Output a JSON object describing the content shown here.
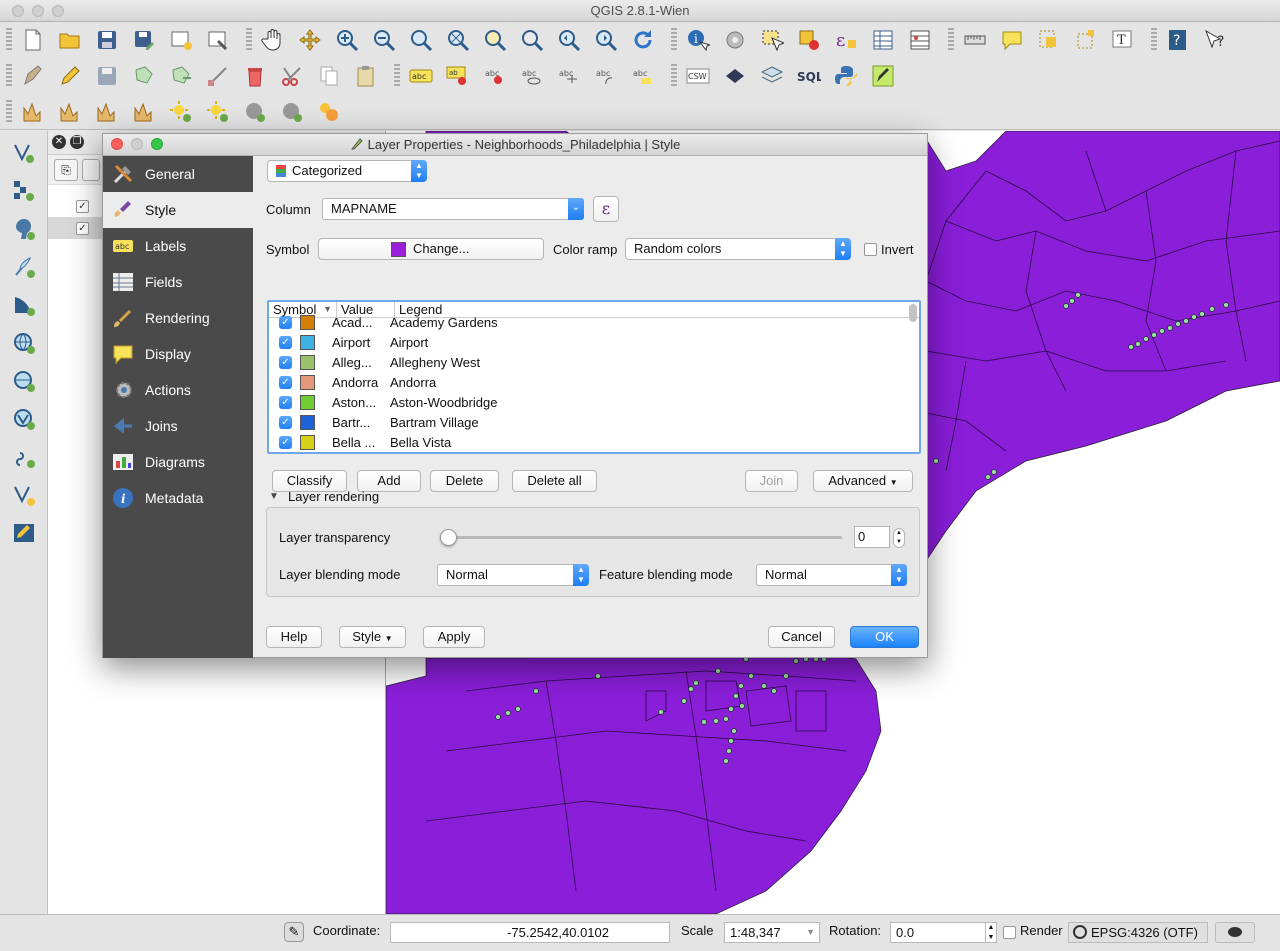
{
  "app": {
    "window_title": "QGIS 2.8.1-Wien"
  },
  "layers_panel": {
    "layers": [
      {
        "checked": "✓"
      },
      {
        "checked": "✓"
      }
    ]
  },
  "statusbar": {
    "coordinate_label": "Coordinate:",
    "coordinate_value": "-75.2542,40.0102",
    "scale_label": "Scale",
    "scale_value": "1:48,347",
    "rotation_label": "Rotation:",
    "rotation_value": "0.0",
    "render_label": "Render",
    "crs_value": "EPSG:4326 (OTF)"
  },
  "dialog": {
    "title": "Layer Properties - Neighborhoods_Philadelphia | Style",
    "sidebar": [
      {
        "label": "General",
        "icon": "tools-icon"
      },
      {
        "label": "Style",
        "icon": "paintbrush-icon"
      },
      {
        "label": "Labels",
        "icon": "abc-label-icon"
      },
      {
        "label": "Fields",
        "icon": "table-icon"
      },
      {
        "label": "Rendering",
        "icon": "brush-icon"
      },
      {
        "label": "Display",
        "icon": "speech-bubble-icon"
      },
      {
        "label": "Actions",
        "icon": "gear-icon"
      },
      {
        "label": "Joins",
        "icon": "join-icon"
      },
      {
        "label": "Diagrams",
        "icon": "chart-icon"
      },
      {
        "label": "Metadata",
        "icon": "info-icon"
      }
    ],
    "renderer_type": "Categorized",
    "column_label": "Column",
    "column_value": "MAPNAME",
    "expression_glyph": "ε",
    "symbol_label": "Symbol",
    "change_label": "Change...",
    "symbol_color": "#9b1fd8",
    "color_ramp_label": "Color ramp",
    "color_ramp_value": "Random colors",
    "invert_label": "Invert",
    "table_headers": {
      "symbol": "Symbol",
      "value": "Value",
      "legend": "Legend"
    },
    "categories": [
      {
        "color": "#d17f05",
        "value": "Acad...",
        "legend": "Academy Gardens"
      },
      {
        "color": "#3fb2e4",
        "value": "Airport",
        "legend": "Airport"
      },
      {
        "color": "#99c26b",
        "value": "Alleg...",
        "legend": "Allegheny West"
      },
      {
        "color": "#e5977a",
        "value": "Andorra",
        "legend": "Andorra"
      },
      {
        "color": "#6fcc33",
        "value": "Aston...",
        "legend": "Aston-Woodbridge"
      },
      {
        "color": "#1d62d6",
        "value": "Bartr...",
        "legend": "Bartram Village"
      },
      {
        "color": "#d6d01a",
        "value": "Bella ...",
        "legend": "Bella Vista"
      }
    ],
    "buttons": {
      "classify": "Classify",
      "add": "Add",
      "delete": "Delete",
      "delete_all": "Delete all",
      "join": "Join",
      "advanced": "Advanced",
      "help": "Help",
      "style": "Style",
      "apply": "Apply",
      "cancel": "Cancel",
      "ok": "OK"
    },
    "layer_rendering": {
      "section_label": "Layer rendering",
      "transparency_label": "Layer transparency",
      "transparency_value": "0",
      "transparency_level": 0,
      "blending_label": "Layer blending mode",
      "blending_value": "Normal",
      "feature_blending_label": "Feature blending mode",
      "feature_blending_value": "Normal"
    }
  },
  "map": {
    "fill_color": "#8a1ed9",
    "point_color": "#9be3a0"
  }
}
